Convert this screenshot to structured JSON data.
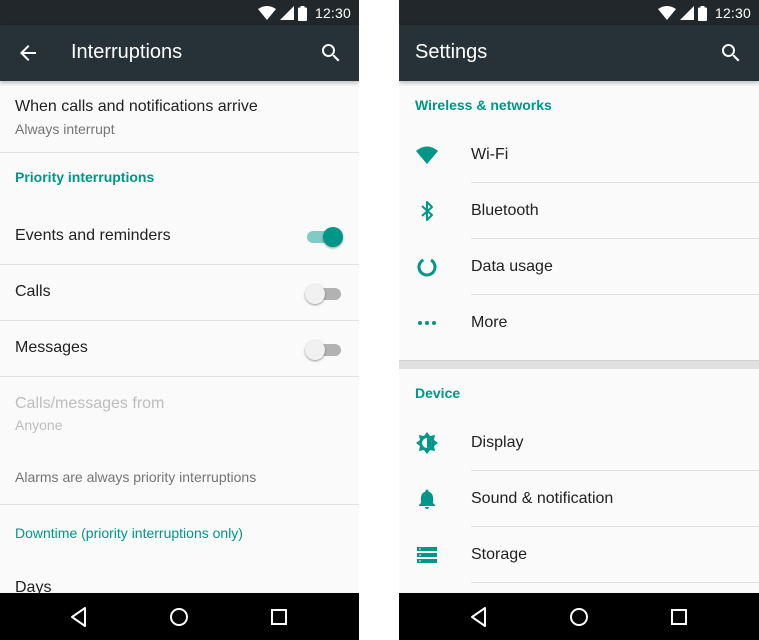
{
  "status": {
    "time": "12:30"
  },
  "interruptions": {
    "title": "Interruptions",
    "when_arrive": {
      "title": "When calls and notifications arrive",
      "subtitle": "Always interrupt"
    },
    "priority_header": "Priority interruptions",
    "events": {
      "label": "Events and reminders",
      "enabled": true
    },
    "calls": {
      "label": "Calls",
      "enabled": false
    },
    "messages": {
      "label": "Messages",
      "enabled": false
    },
    "calls_from": {
      "title": "Calls/messages from",
      "subtitle": "Anyone"
    },
    "alarms_note": "Alarms are always priority interruptions",
    "downtime_header": "Downtime (priority interruptions only)",
    "days_label": "Days"
  },
  "settings": {
    "title": "Settings",
    "wireless_header": "Wireless & networks",
    "wireless_items": [
      {
        "label": "Wi-Fi",
        "icon": "wifi-icon"
      },
      {
        "label": "Bluetooth",
        "icon": "bluetooth-icon"
      },
      {
        "label": "Data usage",
        "icon": "data-usage-icon"
      },
      {
        "label": "More",
        "icon": "more-icon"
      }
    ],
    "device_header": "Device",
    "device_items": [
      {
        "label": "Display",
        "icon": "display-brightness-icon"
      },
      {
        "label": "Sound & notification",
        "icon": "bell-icon"
      },
      {
        "label": "Storage",
        "icon": "storage-icon"
      }
    ]
  },
  "colors": {
    "accent": "#009688",
    "appbar": "#263238",
    "statusbar": "#21272b"
  }
}
